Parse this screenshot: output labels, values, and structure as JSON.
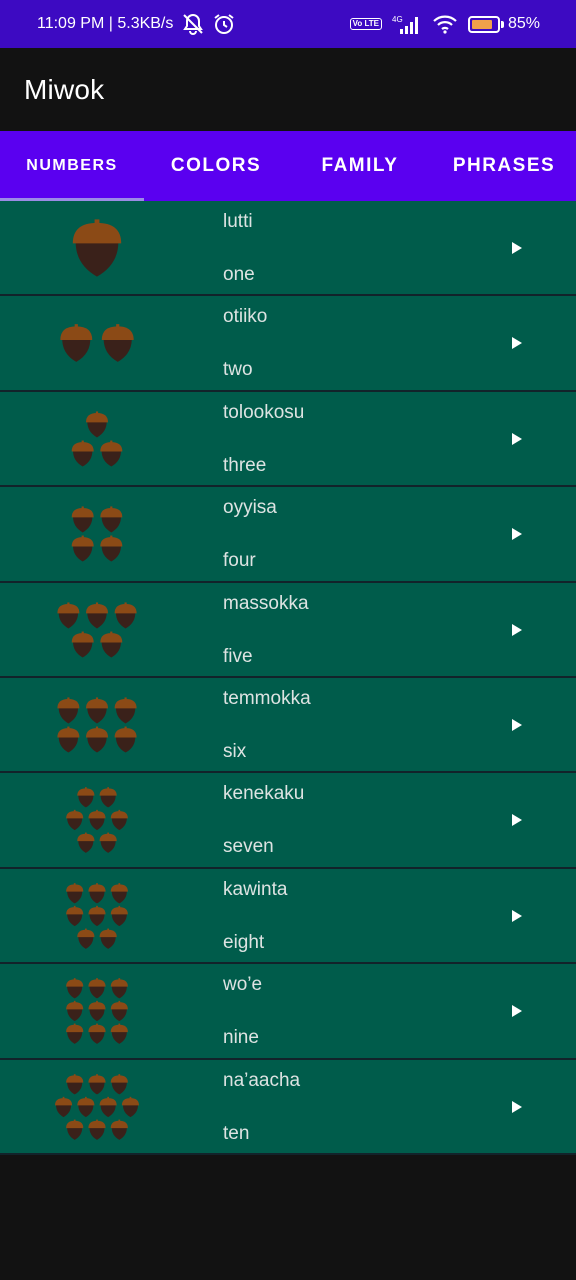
{
  "status_bar": {
    "time_speed": "11:09 PM | 5.3KB/s",
    "volte": "Vo LTE",
    "network": "4G",
    "battery_percent": "85%",
    "battery_level": 0.85,
    "icons": [
      "mute-notifications-icon",
      "alarm-icon",
      "volte-icon",
      "signal-icon",
      "wifi-icon",
      "battery-icon"
    ]
  },
  "app_bar": {
    "title": "Miwok"
  },
  "tabs": [
    {
      "label": "NUMBERS",
      "active": true
    },
    {
      "label": "COLORS",
      "active": false
    },
    {
      "label": "FAMILY",
      "active": false
    },
    {
      "label": "PHRASES",
      "active": false
    }
  ],
  "colors": {
    "status_bar": "#3d0ac2",
    "tab_bar": "#5a00f0",
    "row_background": "#005c4b",
    "acorn_cap": "#8b4a16",
    "acorn_body": "#3a211a"
  },
  "words": [
    {
      "miwok": "lutti",
      "english": "one",
      "acorns": 1
    },
    {
      "miwok": "otiiko",
      "english": "two",
      "acorns": 2
    },
    {
      "miwok": "tolookosu",
      "english": "three",
      "acorns": 3
    },
    {
      "miwok": "oyyisa",
      "english": "four",
      "acorns": 4
    },
    {
      "miwok": "massokka",
      "english": "five",
      "acorns": 5
    },
    {
      "miwok": "temmokka",
      "english": "six",
      "acorns": 6
    },
    {
      "miwok": "kenekaku",
      "english": "seven",
      "acorns": 7
    },
    {
      "miwok": "kawinta",
      "english": "eight",
      "acorns": 8
    },
    {
      "miwok": "wo’e",
      "english": "nine",
      "acorns": 9
    },
    {
      "miwok": "na’aacha",
      "english": "ten",
      "acorns": 10
    }
  ]
}
